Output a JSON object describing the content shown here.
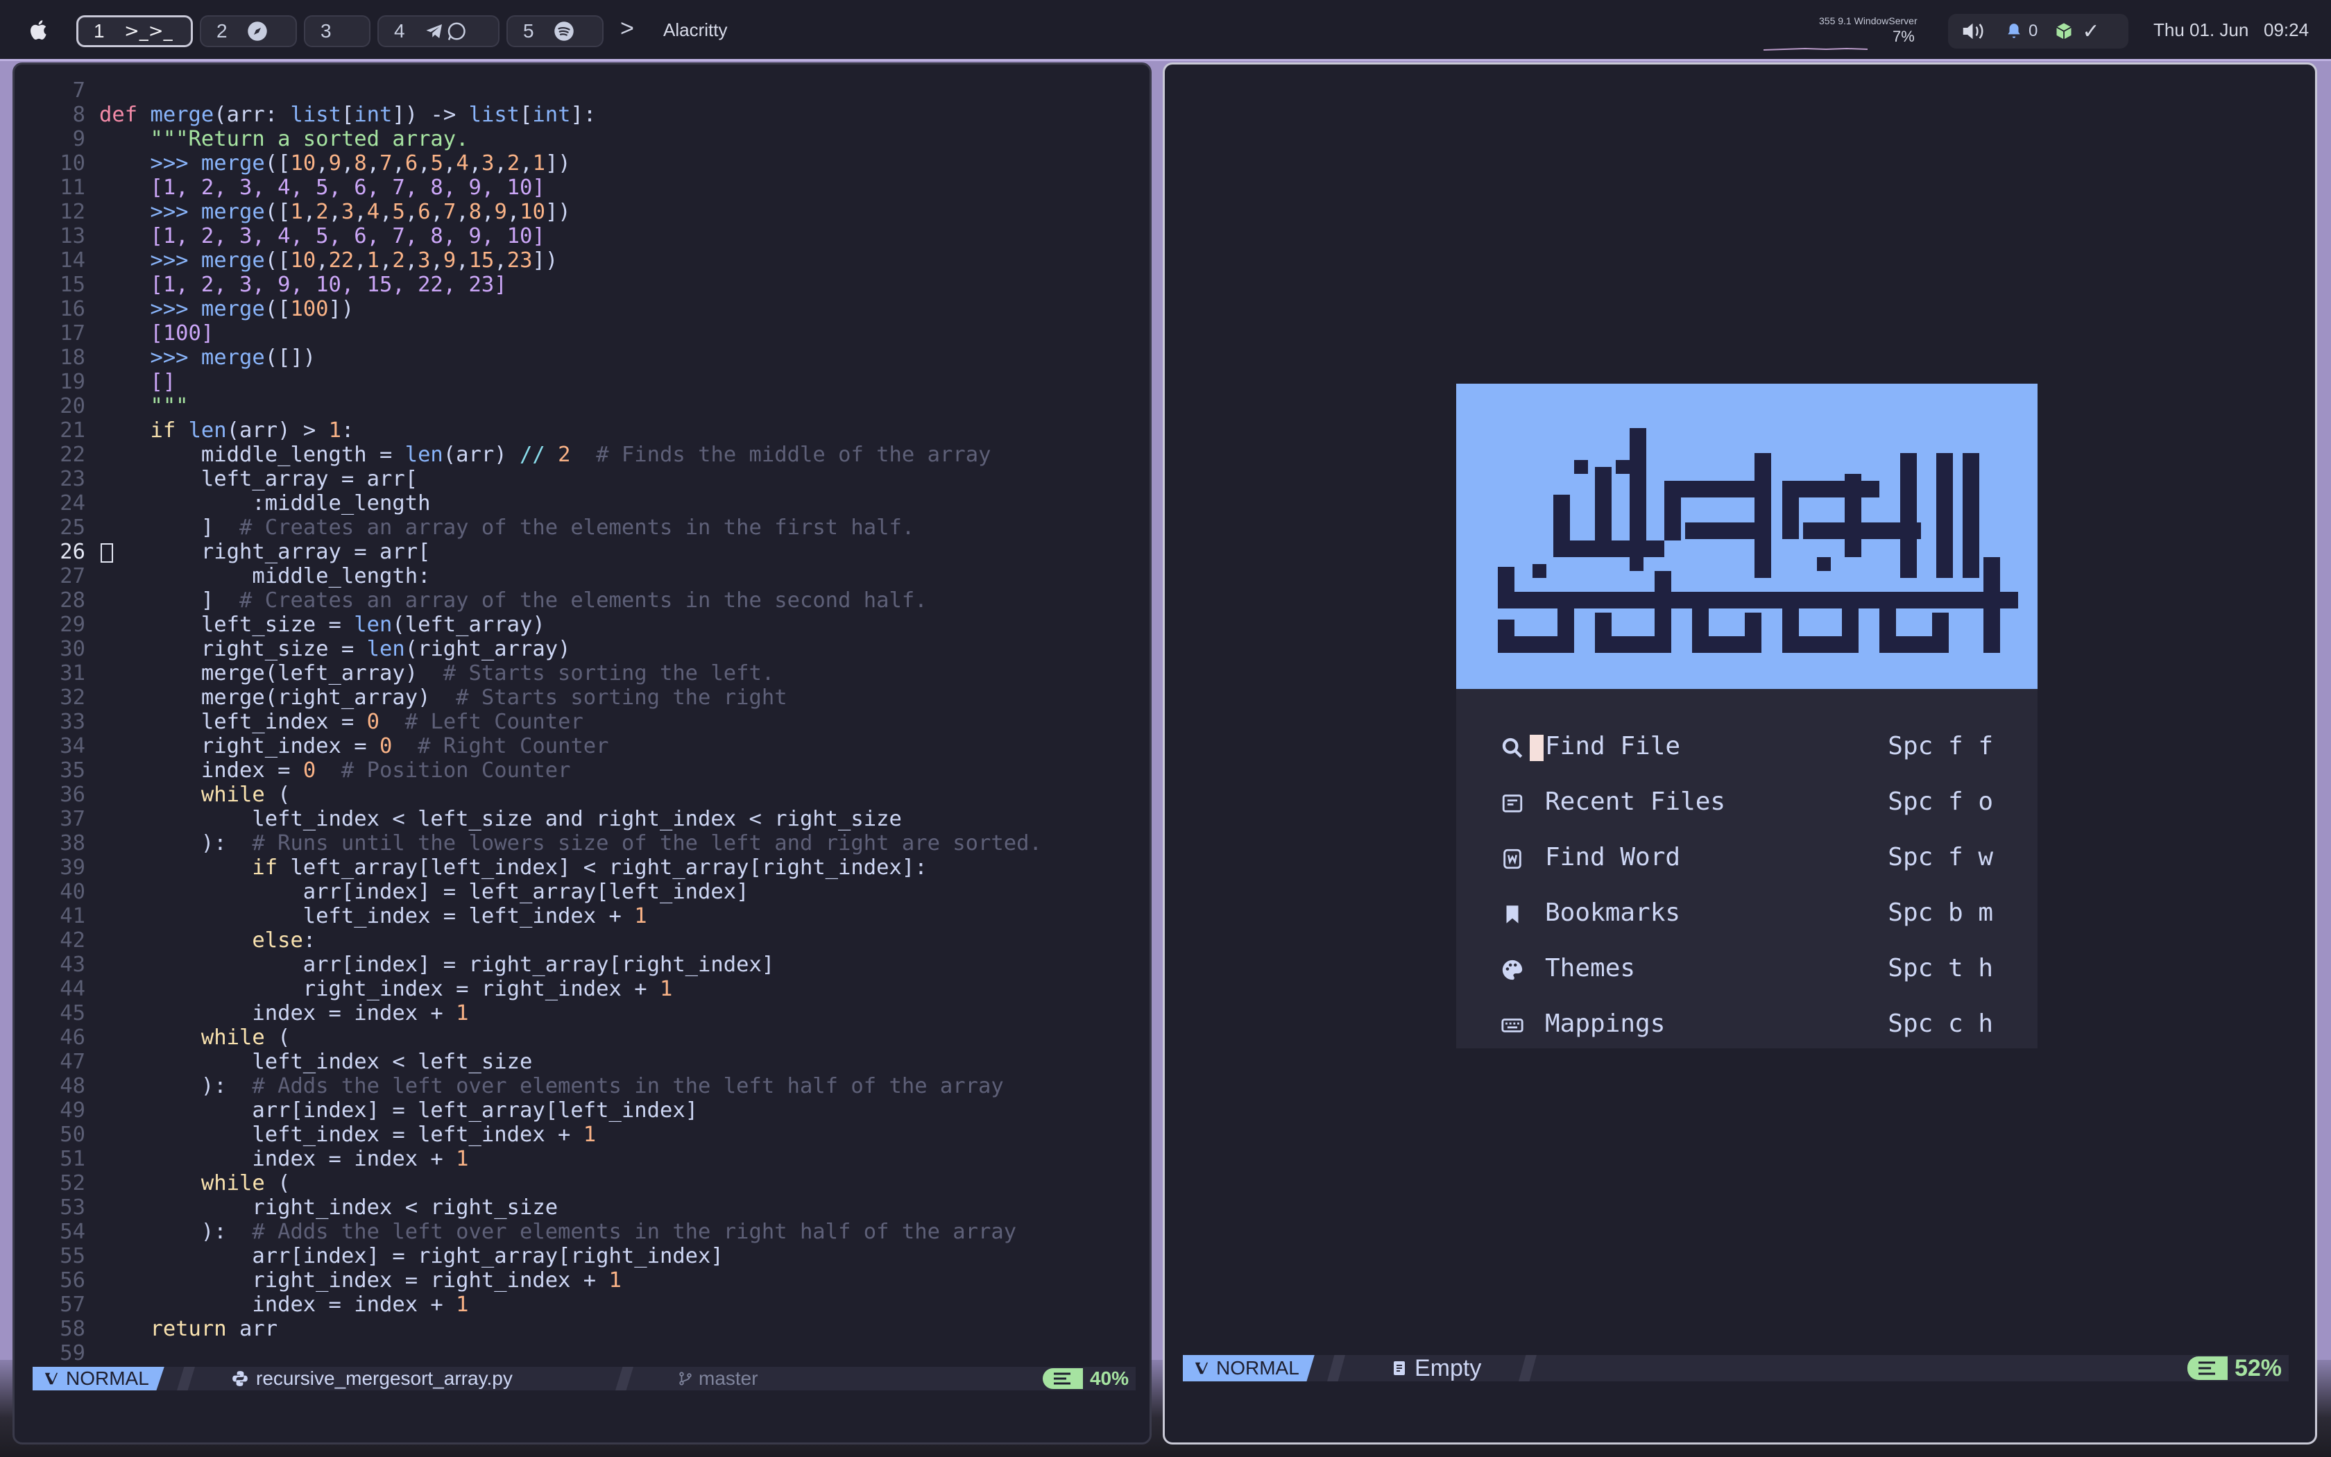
{
  "topbar": {
    "workspaces": [
      {
        "num": "1",
        "icon": ">_>_",
        "active": true
      },
      {
        "num": "2",
        "icon": "compass-icon"
      },
      {
        "num": "3",
        "icon": ""
      },
      {
        "num": "4",
        "icon": "telegram-whatsapp-icons"
      },
      {
        "num": "5",
        "icon": "spotify-icon"
      }
    ],
    "chevron": ">",
    "app_title": "Alacritty",
    "cpu": {
      "top_text": "355  9.1 WindowServer",
      "percent_text": "7%"
    },
    "notification_count": "0",
    "checkmark": "✓",
    "date": "Thu 01. Jun",
    "time": "09:24"
  },
  "editor": {
    "current_line": 26,
    "lines": [
      {
        "n": "7",
        "html": ""
      },
      {
        "n": "8",
        "html": "<span class='k'>def</span> <span class='f'>merge</span>(arr: <span class='t'>list</span>[<span class='t'>int</span>]) -&gt; <span class='t'>list</span>[<span class='t'>int</span>]:"
      },
      {
        "n": "9",
        "html": "    <span class='s'>\"\"\"Return a sorted array.</span>"
      },
      {
        "n": "10",
        "html": "    <span class='f'>&gt;&gt;&gt; merge</span>([<span class='n'>10</span>,<span class='n'>9</span>,<span class='n'>8</span>,<span class='n'>7</span>,<span class='n'>6</span>,<span class='n'>5</span>,<span class='n'>4</span>,<span class='n'>3</span>,<span class='n'>2</span>,<span class='n'>1</span>])"
      },
      {
        "n": "11",
        "html": "    <span class='p'>[1, 2, 3, 4, 5, 6, 7, 8, 9, 10]</span>"
      },
      {
        "n": "12",
        "html": "    <span class='f'>&gt;&gt;&gt; merge</span>([<span class='n'>1</span>,<span class='n'>2</span>,<span class='n'>3</span>,<span class='n'>4</span>,<span class='n'>5</span>,<span class='n'>6</span>,<span class='n'>7</span>,<span class='n'>8</span>,<span class='n'>9</span>,<span class='n'>10</span>])"
      },
      {
        "n": "13",
        "html": "    <span class='p'>[1, 2, 3, 4, 5, 6, 7, 8, 9, 10]</span>"
      },
      {
        "n": "14",
        "html": "    <span class='f'>&gt;&gt;&gt; merge</span>([<span class='n'>10</span>,<span class='n'>22</span>,<span class='n'>1</span>,<span class='n'>2</span>,<span class='n'>3</span>,<span class='n'>9</span>,<span class='n'>15</span>,<span class='n'>23</span>])"
      },
      {
        "n": "15",
        "html": "    <span class='p'>[1, 2, 3, 9, 10, 15, 22, 23]</span>"
      },
      {
        "n": "16",
        "html": "    <span class='f'>&gt;&gt;&gt; merge</span>([<span class='n'>100</span>])"
      },
      {
        "n": "17",
        "html": "    <span class='p'>[100]</span>"
      },
      {
        "n": "18",
        "html": "    <span class='f'>&gt;&gt;&gt; merge</span>([])"
      },
      {
        "n": "19",
        "html": "    <span class='p'>[]</span>"
      },
      {
        "n": "20",
        "html": "    <span class='s'>\"\"\"</span>"
      },
      {
        "n": "21",
        "html": "    <span class='kw'>if</span> <span class='f'>len</span>(arr) &gt; <span class='n'>1</span>:"
      },
      {
        "n": "22",
        "html": "        middle_length = <span class='f'>len</span>(arr) <span class='op'>//</span> <span class='n'>2</span>  <span class='c'># Finds the middle of the array</span>"
      },
      {
        "n": "23",
        "html": "        left_array = arr["
      },
      {
        "n": "24",
        "html": "            :middle_length"
      },
      {
        "n": "25",
        "html": "        ]  <span class='c'># Creates an array of the elements in the first half.</span>"
      },
      {
        "n": "26",
        "html": "        right_array = arr["
      },
      {
        "n": "27",
        "html": "            middle_length:"
      },
      {
        "n": "28",
        "html": "        ]  <span class='c'># Creates an array of the elements in the second half.</span>"
      },
      {
        "n": "29",
        "html": "        left_size = <span class='f'>len</span>(left_array)"
      },
      {
        "n": "30",
        "html": "        right_size = <span class='f'>len</span>(right_array)"
      },
      {
        "n": "31",
        "html": "        merge(left_array)  <span class='c'># Starts sorting the left.</span>"
      },
      {
        "n": "32",
        "html": "        merge(right_array)  <span class='c'># Starts sorting the right</span>"
      },
      {
        "n": "33",
        "html": "        left_index = <span class='n'>0</span>  <span class='c'># Left Counter</span>"
      },
      {
        "n": "34",
        "html": "        right_index = <span class='n'>0</span>  <span class='c'># Right Counter</span>"
      },
      {
        "n": "35",
        "html": "        index = <span class='n'>0</span>  <span class='c'># Position Counter</span>"
      },
      {
        "n": "36",
        "html": "        <span class='kw'>while</span> ("
      },
      {
        "n": "37",
        "html": "            left_index &lt; left_size and right_index &lt; right_size"
      },
      {
        "n": "38",
        "html": "        ):  <span class='c'># Runs until the lowers size of the left and right are sorted.</span>"
      },
      {
        "n": "39",
        "html": "            <span class='kw'>if</span> left_array[left_index] &lt; right_array[right_index]:"
      },
      {
        "n": "40",
        "html": "                arr[index] = left_array[left_index]"
      },
      {
        "n": "41",
        "html": "                left_index = left_index + <span class='n'>1</span>"
      },
      {
        "n": "42",
        "html": "            <span class='kw'>else</span>:"
      },
      {
        "n": "43",
        "html": "                arr[index] = right_array[right_index]"
      },
      {
        "n": "44",
        "html": "                right_index = right_index + <span class='n'>1</span>"
      },
      {
        "n": "45",
        "html": "            index = index + <span class='n'>1</span>"
      },
      {
        "n": "46",
        "html": "        <span class='kw'>while</span> ("
      },
      {
        "n": "47",
        "html": "            left_index &lt; left_size"
      },
      {
        "n": "48",
        "html": "        ):  <span class='c'># Adds the left over elements in the left half of the array</span>"
      },
      {
        "n": "49",
        "html": "            arr[index] = left_array[left_index]"
      },
      {
        "n": "50",
        "html": "            left_index = left_index + <span class='n'>1</span>"
      },
      {
        "n": "51",
        "html": "            index = index + <span class='n'>1</span>"
      },
      {
        "n": "52",
        "html": "        <span class='kw'>while</span> ("
      },
      {
        "n": "53",
        "html": "            right_index &lt; right_size"
      },
      {
        "n": "54",
        "html": "        ):  <span class='c'># Adds the left over elements in the right half of the array</span>"
      },
      {
        "n": "55",
        "html": "            arr[index] = right_array[right_index]"
      },
      {
        "n": "56",
        "html": "            right_index = right_index + <span class='n'>1</span>"
      },
      {
        "n": "57",
        "html": "            index = index + <span class='n'>1</span>"
      },
      {
        "n": "58",
        "html": "    <span class='kw'>return</span> arr"
      },
      {
        "n": "59",
        "html": ""
      }
    ],
    "status": {
      "mode": "NORMAL",
      "filename": "recursive_mergesort_array.py",
      "branch": "master",
      "percent": "40%"
    }
  },
  "dashboard": {
    "logo_text": "العلم قبل القول والعمل",
    "items": [
      {
        "label": "Find File",
        "key": "Spc f f",
        "icon": "search-icon"
      },
      {
        "label": "Recent Files",
        "key": "Spc f o",
        "icon": "recent-files-icon"
      },
      {
        "label": "Find Word",
        "key": "Spc f w",
        "icon": "find-word-icon"
      },
      {
        "label": "Bookmarks",
        "key": "Spc b m",
        "icon": "bookmark-icon"
      },
      {
        "label": "Themes",
        "key": "Spc t h",
        "icon": "palette-icon"
      },
      {
        "label": "Mappings",
        "key": "Spc c h",
        "icon": "keyboard-icon"
      }
    ],
    "status": {
      "mode": "NORMAL",
      "buffer": "Empty",
      "percent": "52%"
    }
  },
  "colors": {
    "accent": "#89b4fa",
    "green": "#a6e3a1",
    "bg": "#1f1f2c"
  }
}
